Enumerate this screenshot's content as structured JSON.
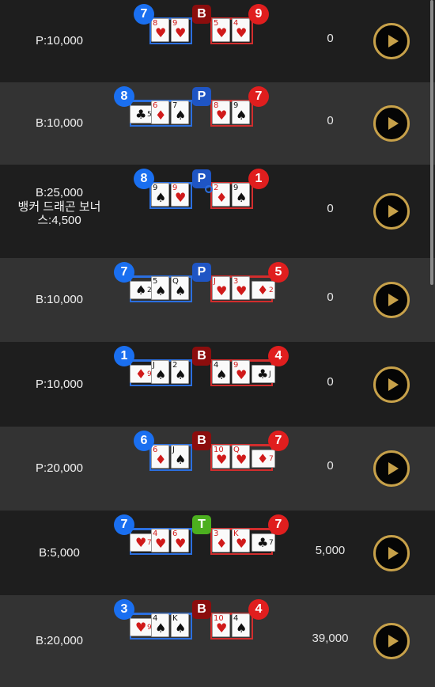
{
  "colors": {
    "player_blue": "#1a6ff0",
    "banker_red": "#e01e1e",
    "banker_badge": "#8b0d0d",
    "player_badge": "#1f55c4",
    "tie_green": "#4caf1f",
    "gold": "#c7a14a"
  },
  "play_icon": "play-icon",
  "rounds": [
    {
      "bet": "P:10,000",
      "bonus": "",
      "winnings": "0",
      "player_score": "7",
      "banker_score": "9",
      "result": "B",
      "player_cards": [
        {
          "rank": "8",
          "suit": "♥"
        },
        {
          "rank": "9",
          "suit": "♥"
        }
      ],
      "banker_cards": [
        {
          "rank": "5",
          "suit": "♥"
        },
        {
          "rank": "4",
          "suit": "♥"
        }
      ]
    },
    {
      "bet": "B:10,000",
      "bonus": "",
      "winnings": "0",
      "player_score": "8",
      "banker_score": "7",
      "result": "P",
      "player_cards": [
        {
          "rank": "5",
          "suit": "♣"
        },
        {
          "rank": "6",
          "suit": "♦"
        },
        {
          "rank": "7",
          "suit": "♠"
        }
      ],
      "banker_cards": [
        {
          "rank": "8",
          "suit": "♥"
        },
        {
          "rank": "9",
          "suit": "♠"
        }
      ]
    },
    {
      "bet": "B:25,000",
      "bonus": "뱅커 드래곤 보너스:4,500",
      "winnings": "0",
      "player_score": "8",
      "banker_score": "1",
      "result": "P",
      "player_cards": [
        {
          "rank": "9",
          "suit": "♠"
        },
        {
          "rank": "9",
          "suit": "♥"
        }
      ],
      "banker_cards": [
        {
          "rank": "2",
          "suit": "♦"
        },
        {
          "rank": "9",
          "suit": "♠"
        }
      ]
    },
    {
      "bet": "B:10,000",
      "bonus": "",
      "winnings": "0",
      "player_score": "7",
      "banker_score": "5",
      "result": "P",
      "player_cards": [
        {
          "rank": "2",
          "suit": "♠"
        },
        {
          "rank": "5",
          "suit": "♠"
        },
        {
          "rank": "Q",
          "suit": "♠"
        }
      ],
      "banker_cards": [
        {
          "rank": "J",
          "suit": "♥"
        },
        {
          "rank": "3",
          "suit": "♥"
        },
        {
          "rank": "2",
          "suit": "♦"
        }
      ]
    },
    {
      "bet": "P:10,000",
      "bonus": "",
      "winnings": "0",
      "player_score": "1",
      "banker_score": "4",
      "result": "B",
      "player_cards": [
        {
          "rank": "9",
          "suit": "♦"
        },
        {
          "rank": "J",
          "suit": "♠"
        },
        {
          "rank": "2",
          "suit": "♠"
        }
      ],
      "banker_cards": [
        {
          "rank": "4",
          "suit": "♠"
        },
        {
          "rank": "9",
          "suit": "♥"
        },
        {
          "rank": "J",
          "suit": "♣"
        }
      ]
    },
    {
      "bet": "P:20,000",
      "bonus": "",
      "winnings": "0",
      "player_score": "6",
      "banker_score": "7",
      "result": "B",
      "player_cards": [
        {
          "rank": "6",
          "suit": "♦"
        },
        {
          "rank": "J",
          "suit": "♠"
        }
      ],
      "banker_cards": [
        {
          "rank": "10",
          "suit": "♥"
        },
        {
          "rank": "Q",
          "suit": "♥"
        },
        {
          "rank": "7",
          "suit": "♦"
        }
      ]
    },
    {
      "bet": "B:5,000",
      "bonus": "",
      "winnings": "5,000",
      "player_score": "7",
      "banker_score": "7",
      "result": "T",
      "player_cards": [
        {
          "rank": "7",
          "suit": "♥"
        },
        {
          "rank": "4",
          "suit": "♥"
        },
        {
          "rank": "6",
          "suit": "♥"
        }
      ],
      "banker_cards": [
        {
          "rank": "3",
          "suit": "♦"
        },
        {
          "rank": "K",
          "suit": "♥"
        },
        {
          "rank": "7",
          "suit": "♣"
        }
      ]
    },
    {
      "bet": "B:20,000",
      "bonus": "",
      "winnings": "39,000",
      "player_score": "3",
      "banker_score": "4",
      "result": "B",
      "player_cards": [
        {
          "rank": "9",
          "suit": "♥"
        },
        {
          "rank": "4",
          "suit": "♠"
        },
        {
          "rank": "K",
          "suit": "♠"
        }
      ],
      "banker_cards": [
        {
          "rank": "10",
          "suit": "♥"
        },
        {
          "rank": "4",
          "suit": "♠"
        }
      ]
    }
  ]
}
